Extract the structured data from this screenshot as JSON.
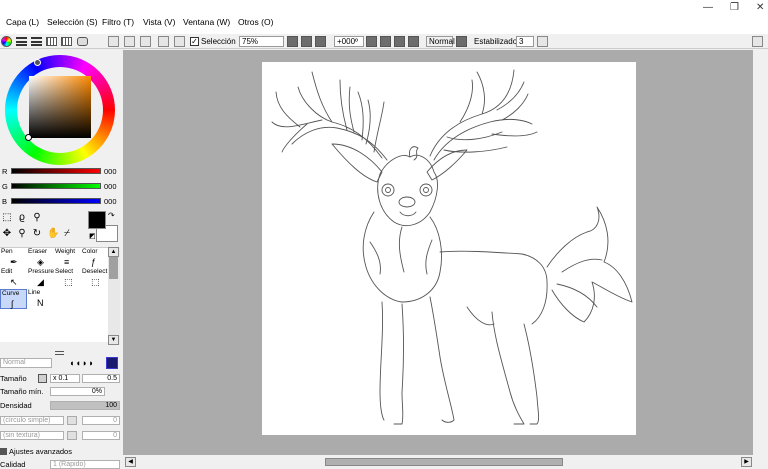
{
  "menu": [
    "Capa (L)",
    "Selección (S)",
    "Filtro (T)",
    "Vista (V)",
    "Ventana (W)",
    "Otros (O)"
  ],
  "window_controls": {
    "minimize": "—",
    "restore": "❐",
    "close": "✕"
  },
  "toolbar": {
    "selection_label": "Selección",
    "zoom": "75%",
    "rotation": "+000º",
    "blend_mode": "Normal",
    "stabilizer_label": "Estabilizador",
    "stabilizer_value": "3"
  },
  "color": {
    "r_label": "R",
    "r_value": "000",
    "g_label": "G",
    "g_value": "000",
    "b_label": "B",
    "b_value": "000"
  },
  "tools": [
    {
      "label": "Pen",
      "icon": "pen-icon",
      "glyph": "✒"
    },
    {
      "label": "Eraser",
      "icon": "eraser-icon",
      "glyph": "◈"
    },
    {
      "label": "Weight",
      "icon": "weight-icon",
      "glyph": "≡"
    },
    {
      "label": "Color",
      "icon": "color-icon",
      "glyph": "ƒ"
    },
    {
      "label": "Edit",
      "icon": "edit-icon",
      "glyph": "↖"
    },
    {
      "label": "Pressure",
      "icon": "pressure-icon",
      "glyph": "◢"
    },
    {
      "label": "Select",
      "icon": "select-icon",
      "glyph": "⬚"
    },
    {
      "label": "Deselect",
      "icon": "deselect-icon",
      "glyph": "⬚"
    },
    {
      "label": "Curve",
      "icon": "curve-icon",
      "glyph": "∫"
    },
    {
      "label": "Line",
      "icon": "line-icon",
      "glyph": "N"
    }
  ],
  "brush": {
    "mode": "Normal",
    "size_label": "Tamaño",
    "size_multiplier": "x 0.1",
    "size_value": "0.5",
    "min_size_label": "Tamaño mín.",
    "min_size_value": "0%",
    "density_label": "Densidad",
    "density_value": "100",
    "shape": "(círculo simple)",
    "shape_value": "0",
    "texture": "(sin textura)",
    "texture_value": "0",
    "advanced_label": "Ajustes avanzados",
    "quality_label": "Calidad",
    "quality_value": "1 (Rápido)"
  }
}
